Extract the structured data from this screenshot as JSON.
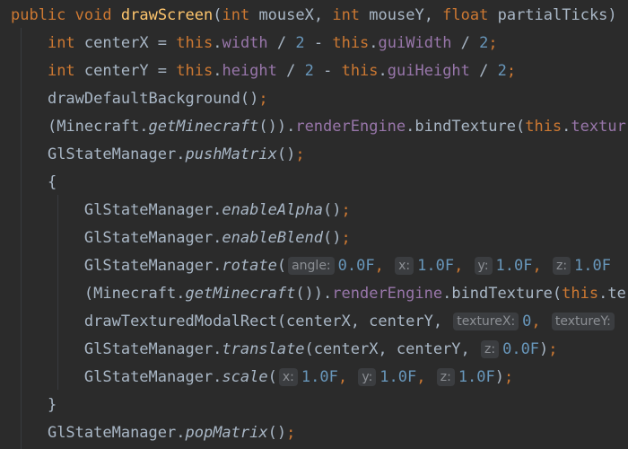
{
  "colors": {
    "background": "#2b2b2b",
    "keyword": "#cc7832",
    "method_declaration": "#ffc66d",
    "field": "#9876aa",
    "number": "#6897bb",
    "default_text": "#a9b7c6",
    "inlay_hint_bg": "#3b3d40",
    "inlay_hint_text": "#8c8f94"
  },
  "code": {
    "line1": {
      "t1": "public",
      "t2": " ",
      "t3": "void",
      "t4": " ",
      "t5": "drawScreen",
      "t6": "(",
      "t7": "int",
      "t8": " mouseX, ",
      "t9": "int",
      "t10": " mouseY, ",
      "t11": "float",
      "t12": " partialTicks)"
    },
    "line2": {
      "t1": "int",
      "t2": " centerX = ",
      "t3": "this",
      "t4": ".",
      "t5": "width",
      "t6": " / ",
      "t7": "2",
      "t8": " - ",
      "t9": "this",
      "t10": ".",
      "t11": "guiWidth",
      "t12": " / ",
      "t13": "2",
      "t14": ";"
    },
    "line3": {
      "t1": "int",
      "t2": " centerY = ",
      "t3": "this",
      "t4": ".",
      "t5": "height",
      "t6": " / ",
      "t7": "2",
      "t8": " - ",
      "t9": "this",
      "t10": ".",
      "t11": "guiHeight",
      "t12": " / ",
      "t13": "2",
      "t14": ";"
    },
    "line4": {
      "t1": "drawDefaultBackground()",
      "t2": ";"
    },
    "line5": {
      "t1": "(Minecraft.",
      "t2": "getMinecraft",
      "t3": "()).",
      "t4": "renderEngine",
      "t5": ".bindTexture(",
      "t6": "this",
      "t7": ".",
      "t8": "textur"
    },
    "line6": {
      "t1": "GlStateManager.",
      "t2": "pushMatrix",
      "t3": "()",
      "t4": ";"
    },
    "line7": {
      "t1": "{"
    },
    "line8": {
      "t1": "GlStateManager.",
      "t2": "enableAlpha",
      "t3": "()",
      "t4": ";"
    },
    "line9": {
      "t1": "GlStateManager.",
      "t2": "enableBlend",
      "t3": "()",
      "t4": ";"
    },
    "line10": {
      "t1": "GlStateManager.",
      "t2": "rotate",
      "t3": "(",
      "h1": "angle:",
      "t4": "0.0F",
      "t5": ", ",
      "h2": "x:",
      "t6": "1.0F",
      "t7": ", ",
      "h3": "y:",
      "t8": "1.0F",
      "t9": ", ",
      "h4": "z:",
      "t10": "1.0F"
    },
    "line11": {
      "t1": "(Minecraft.",
      "t2": "getMinecraft",
      "t3": "()).",
      "t4": "renderEngine",
      "t5": ".bindTexture(",
      "t6": "this",
      "t7": ".te"
    },
    "line12": {
      "t1": "drawTexturedModalRect(centerX, centerY, ",
      "h1": "textureX:",
      "t2": "0",
      "t3": ", ",
      "h2": "textureY:"
    },
    "line13": {
      "t1": "GlStateManager.",
      "t2": "translate",
      "t3": "(centerX, centerY, ",
      "h1": "z:",
      "t4": "0.0F",
      "t5": ")",
      "t6": ";"
    },
    "line14": {
      "t1": "GlStateManager.",
      "t2": "scale",
      "t3": "(",
      "h1": "x:",
      "t4": "1.0F",
      "t5": ", ",
      "h2": "y:",
      "t6": "1.0F",
      "t7": ", ",
      "h3": "z:",
      "t8": "1.0F",
      "t9": ")",
      "t10": ";"
    },
    "line15": {
      "t1": "}"
    },
    "line16": {
      "t1": "GlStateManager.",
      "t2": "popMatrix",
      "t3": "()",
      "t4": ";"
    }
  }
}
